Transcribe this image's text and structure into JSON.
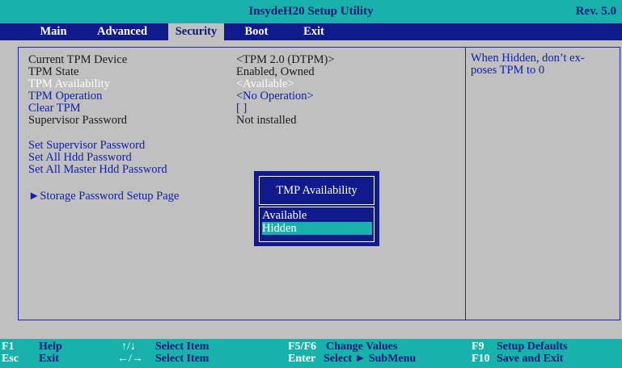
{
  "title_bar": {
    "title": "InsydeH20 Setup Utility",
    "revision": "Rev. 5.0"
  },
  "menu": {
    "items": [
      {
        "label": "Main"
      },
      {
        "label": "Advanced"
      },
      {
        "label": "Security",
        "active": true
      },
      {
        "label": "Boot"
      },
      {
        "label": "Exit"
      }
    ]
  },
  "settings": {
    "current_tpm_device": {
      "label": "Current TPM Device",
      "value": "<TPM 2.0 (DTPM)>"
    },
    "tpm_state": {
      "label": "TPM State",
      "value": "Enabled, Owned"
    },
    "tpm_availability": {
      "label": "TPM Availability",
      "value": "<Available>"
    },
    "tpm_operation": {
      "label": "TPM Operation",
      "value": "<No Operation>"
    },
    "clear_tpm": {
      "label": "Clear TPM",
      "value": "[ ]"
    },
    "supervisor_password": {
      "label": "Supervisor Password",
      "value": "Not installed"
    },
    "set_supervisor_password": {
      "label": "Set Supervisor Password"
    },
    "set_all_hdd_password": {
      "label": "Set All Hdd Password"
    },
    "set_all_master_hdd_password": {
      "label": "Set All Master Hdd Password"
    },
    "storage_password_setup_page": {
      "label": "►Storage Password Setup Page"
    }
  },
  "help_text": "When Hidden, don’t exposes TPM to 0",
  "help_lines": [
    "When Hidden, don’t ex-",
    "poses TPM to 0"
  ],
  "popup": {
    "title": "TMP Availability",
    "options": [
      {
        "label": "Available",
        "selected": false
      },
      {
        "label": "Hidden",
        "selected": true
      }
    ]
  },
  "footer": {
    "help": {
      "key": "F1",
      "desc": "Help"
    },
    "exit": {
      "key": "Esc",
      "desc": "Exit"
    },
    "select_item_up": {
      "key": "↑/↓",
      "desc": "Select Item"
    },
    "select_item_lr": {
      "key": "←/→",
      "desc": "Select Item"
    },
    "change_values": {
      "key": "F5/F6",
      "desc": "Change Values"
    },
    "submenu": {
      "key": "Enter",
      "desc": "Select ► SubMenu"
    },
    "setup_defaults": {
      "key": "F9",
      "desc": "Setup Defaults"
    },
    "save_exit": {
      "key": "F10",
      "desc": "Save and Exit"
    }
  },
  "colors": {
    "title_bar_bg": "#19b1ac",
    "menu_bg": "#101a8a",
    "body_bg": "#c0c0c0",
    "link_text": "#1020a8",
    "highlight": "#19b1ac"
  }
}
